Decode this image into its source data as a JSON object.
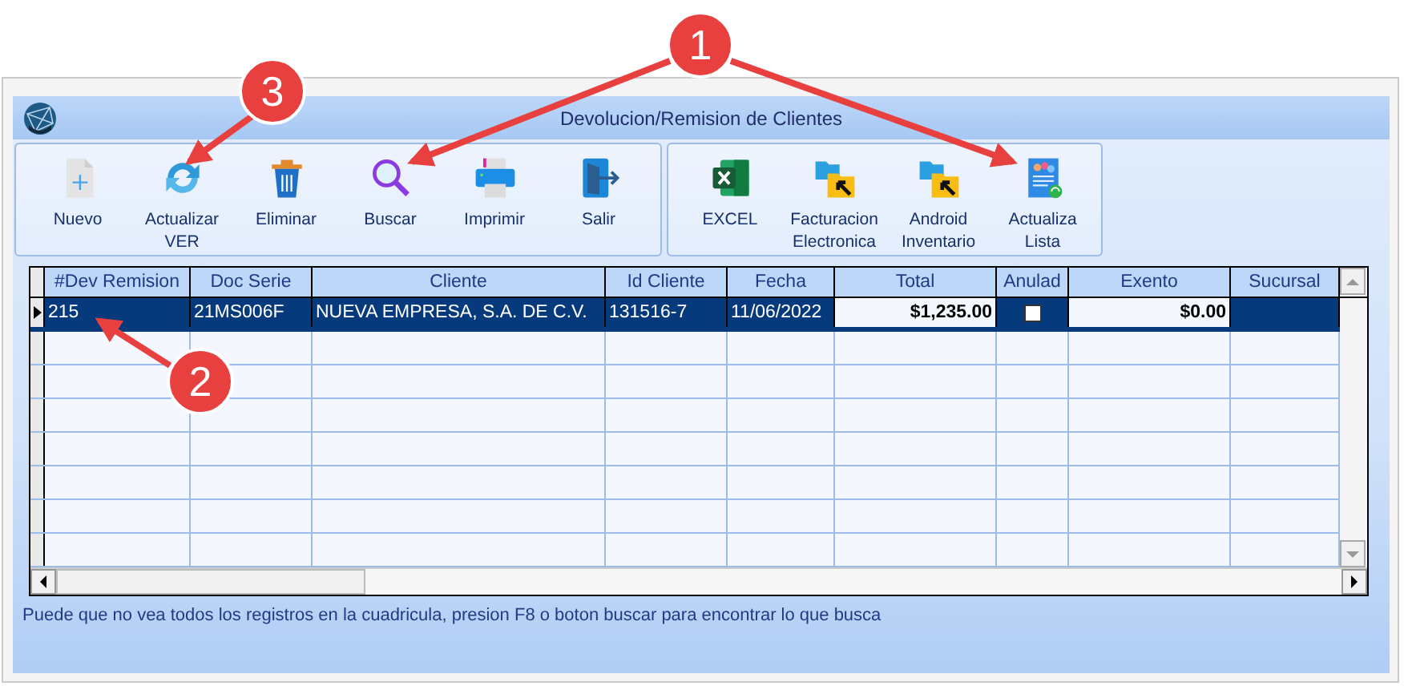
{
  "window": {
    "title": "Devolucion/Remision de Clientes"
  },
  "toolbar_groups": [
    {
      "buttons": [
        {
          "label": "Nuevo"
        },
        {
          "label": "Actualizar VER"
        },
        {
          "label": "Eliminar"
        },
        {
          "label": "Buscar"
        },
        {
          "label": "Imprimir"
        },
        {
          "label": "Salir"
        }
      ]
    },
    {
      "buttons": [
        {
          "label": "EXCEL"
        },
        {
          "label": "Facturacion Electronica"
        },
        {
          "label": "Android Inventario"
        },
        {
          "label": "Actualiza Lista"
        }
      ]
    }
  ],
  "table": {
    "columns": [
      "#Dev Remision",
      "Doc Serie",
      "Cliente",
      "Id Cliente",
      "Fecha",
      "Total",
      "Anulad",
      "Exento",
      "Sucursal"
    ],
    "rows": [
      {
        "selected": true,
        "dev_remision": "215",
        "doc_serie": "21MS006F",
        "cliente": "NUEVA EMPRESA, S.A. DE C.V.",
        "id_cliente": "131516-7",
        "fecha": "11/06/2022",
        "total": "$1,235.00",
        "anulado": false,
        "exento": "$0.00"
      }
    ]
  },
  "status_text": "Puede que no vea todos los registros en la cuadricula, presion F8 o boton buscar para encontrar lo que busca",
  "callouts": [
    {
      "number": "1"
    },
    {
      "number": "2"
    },
    {
      "number": "3"
    }
  ]
}
